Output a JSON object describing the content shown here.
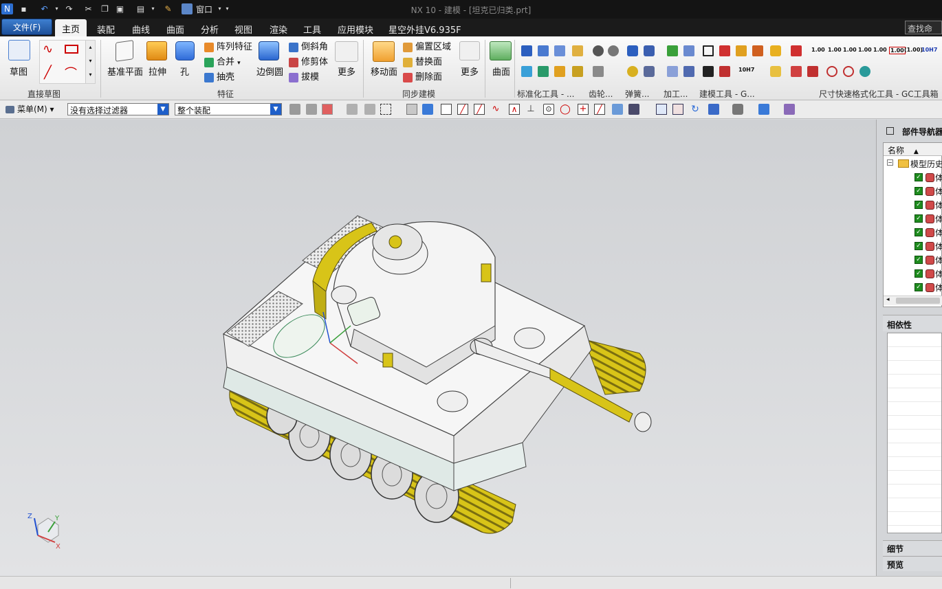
{
  "window": {
    "title": "NX 10 - 建模 - [坦克已归类.prt]",
    "window_menu": "窗口"
  },
  "menu": {
    "file": "文件(F)",
    "tabs": [
      "主页",
      "装配",
      "曲线",
      "曲面",
      "分析",
      "视图",
      "渲染",
      "工具",
      "应用模块",
      "星空外挂V6.935F"
    ],
    "search": "查找命令"
  },
  "ribbon": {
    "sketch_group": {
      "name": "直接草图",
      "sketch": "草图"
    },
    "feature_group": {
      "name": "特征",
      "datum_plane": "基准平面",
      "extrude": "拉伸",
      "hole": "孔",
      "pattern": "阵列特征",
      "unite": "合并",
      "shell": "抽壳",
      "edge_blend": "边倒圆",
      "chamfer": "倒斜角",
      "trim_body": "修剪体",
      "draft": "拔模",
      "more": "更多"
    },
    "sync_group": {
      "name": "同步建模",
      "move_face": "移动面",
      "offset_region": "偏置区域",
      "replace_face": "替换面",
      "delete_face": "删除面",
      "more": "更多"
    },
    "surface_group": {
      "label": "曲面"
    },
    "tool_groups": [
      "标准化工具 - ...",
      "齿轮...",
      "弹簧...",
      "加工...",
      "建模工具 - G...",
      "尺寸快速格式化工具 - GC工具箱"
    ],
    "dim_labels": [
      "1.00",
      "1.00",
      "1.00",
      "1.00",
      "1.00",
      "1.00",
      "(1.00)",
      "10H7",
      "10H7"
    ]
  },
  "toolbar": {
    "menu_button": "菜单(M)",
    "filter": "没有选择过滤器",
    "scope": "整个装配"
  },
  "viewport": {
    "triad_labels": {
      "x": "X",
      "y": "Y",
      "z": "Z"
    }
  },
  "navigator": {
    "title": "部件导航器",
    "column": "名称",
    "root": "模型历史记录",
    "items": [
      "体",
      "体",
      "体",
      "体",
      "体",
      "体",
      "体",
      "体",
      "体"
    ],
    "dependency": "相依性",
    "details": "细节",
    "preview": "预览"
  },
  "colors": {
    "track": "#d8c418",
    "hull": "#f2f2f2",
    "titlebar": "#141414"
  }
}
